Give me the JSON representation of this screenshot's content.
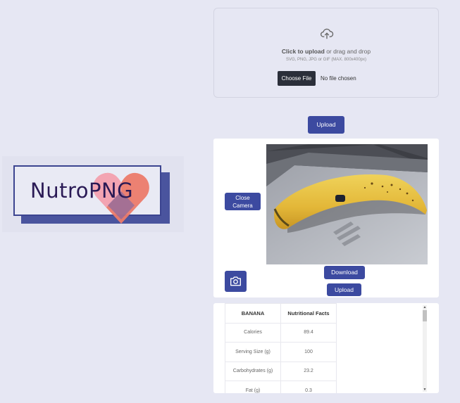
{
  "logo": {
    "text": "NutroPNG",
    "colors": {
      "navy": "#3c4490",
      "pink": "#f4a7b9",
      "coral": "#ec7b6a",
      "ink": "#2a1a55"
    }
  },
  "dropzone": {
    "icon": "cloud-upload-icon",
    "click_label": "Click to upload",
    "drag_text": " or drag and drop",
    "formats_text": "SVG, PNG, JPG or GIF (MAX. 800x400px)",
    "choose_file_label": "Choose File",
    "no_file_text": "No file chosen"
  },
  "upload_top_label": "Upload",
  "camera": {
    "close_label_line1": "Close",
    "close_label_line2": "Camera",
    "capture_icon": "camera-icon",
    "download_label": "Download",
    "upload_label": "Upload"
  },
  "nutrition": {
    "headers": [
      "BANANA",
      "Nutritional Facts"
    ],
    "rows": [
      [
        "Calories",
        "89.4"
      ],
      [
        "Serving Size (g)",
        "100"
      ],
      [
        "Carbohydrates (g)",
        "23.2"
      ],
      [
        "Fat (g)",
        "0.3"
      ]
    ]
  },
  "colors": {
    "page_bg": "#e6e7f3",
    "accent": "#3c4aa0",
    "panel_bg": "#ffffff"
  }
}
